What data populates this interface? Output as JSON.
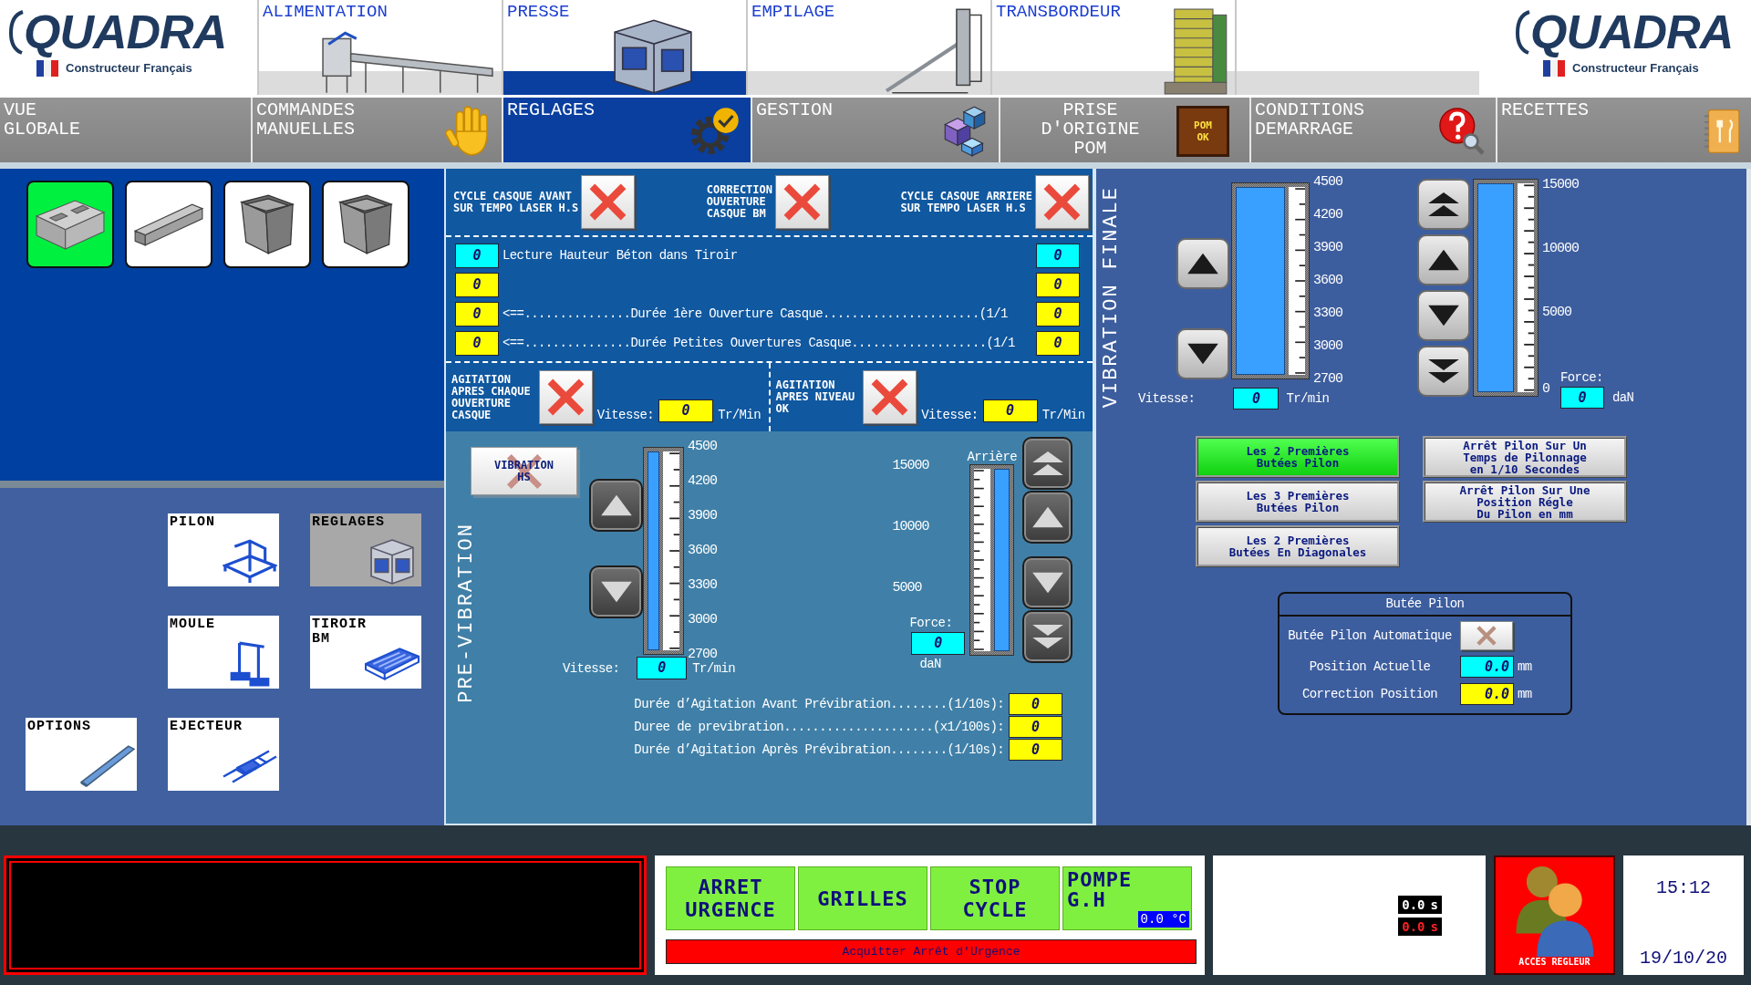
{
  "header": {
    "logos": [
      {
        "brand": "QUADRA",
        "tagline": "Constructeur Français"
      },
      {
        "brand": "QUADRA",
        "tagline": "Constructeur Français"
      }
    ],
    "sections": [
      {
        "label": "ALIMENTATION",
        "selected": false
      },
      {
        "label": "PRESSE",
        "selected": true
      },
      {
        "label": "EMPILAGE",
        "selected": false
      },
      {
        "label": "TRANSBORDEUR",
        "selected": false
      }
    ]
  },
  "menu": [
    {
      "label": "VUE\nGLOBALE",
      "selected": false
    },
    {
      "label": "COMMANDES\nMANUELLES",
      "selected": false
    },
    {
      "label": "REGLAGES",
      "selected": true
    },
    {
      "label": "GESTION",
      "selected": false
    },
    {
      "label": "PRISE\nD'ORIGINE\nPOM",
      "selected": false,
      "badge": "POM\nOK"
    },
    {
      "label": "CONDITIONS\nDEMARRAGE",
      "selected": false
    },
    {
      "label": "RECETTES",
      "selected": false
    }
  ],
  "left_panel": {
    "block_types": [
      {
        "selected": true
      },
      {
        "selected": false
      },
      {
        "selected": false
      },
      {
        "selected": false
      }
    ],
    "components": [
      {
        "label": "PILON",
        "selected": false
      },
      {
        "label": "REGLAGES",
        "selected": true
      },
      {
        "label": "MOULE",
        "selected": false
      },
      {
        "label": "TIROIR\nBM",
        "selected": false
      },
      {
        "label": "OPTIONS",
        "selected": false
      },
      {
        "label": "EJECTEUR",
        "selected": false
      }
    ]
  },
  "casque": {
    "toggles": [
      {
        "label": "CYCLE CASQUE AVANT\nSUR TEMPO LASER H.S",
        "on": false
      },
      {
        "label": "CORRECTION\nOUVERTURE\nCASQUE BM",
        "on": false
      },
      {
        "label": "CYCLE CASQUE ARRIERE\nSUR TEMPO LASER H.S",
        "on": false
      }
    ],
    "rows": [
      {
        "left": {
          "value": "0",
          "kind": "display"
        },
        "text": "Lecture Hauteur Béton dans Tiroir",
        "right": {
          "value": "0",
          "kind": "display"
        }
      },
      {
        "left": {
          "value": "0",
          "kind": "input"
        },
        "right": {
          "value": "0",
          "kind": "input"
        }
      },
      {
        "left": {
          "value": "0",
          "kind": "input"
        },
        "text": "<==...............Durée 1ère Ouverture Casque......................(1/1",
        "right": {
          "value": "0",
          "kind": "input"
        }
      },
      {
        "left": {
          "value": "0",
          "kind": "input"
        },
        "text": "<==...............Durée Petites Ouvertures Casque...................(1/1",
        "right": {
          "value": "0",
          "kind": "input"
        }
      }
    ],
    "agitation": [
      {
        "label": "AGITATION\nAPRES CHAQUE\nOUVERTURE\nCASQUE",
        "on": false,
        "speed_label": "Vitesse:",
        "speed": {
          "value": "0",
          "kind": "input"
        },
        "unit": "Tr/Min"
      },
      {
        "label": "AGITATION\nAPRES NIVEAU\nOK",
        "on": false,
        "speed_label": "Vitesse:",
        "speed": {
          "value": "0",
          "kind": "input"
        },
        "unit": "Tr/Min"
      }
    ]
  },
  "pre_vibration": {
    "title": "PRE-VIBRATION",
    "status": "VIBRATION\nHS",
    "speed": {
      "buttons": [
        {
          "kind": "up"
        },
        {
          "kind": "down"
        }
      ],
      "scale": [
        "4500",
        "4200",
        "3900",
        "3600",
        "3300",
        "3000",
        "2700"
      ],
      "level": 1,
      "label": "Vitesse:",
      "field": {
        "value": "0",
        "kind": "display"
      },
      "unit": "Tr/min"
    },
    "force": {
      "caption": "Arrière",
      "scale": [
        "15000",
        "10000",
        "5000"
      ],
      "level": 1,
      "label": "Force:",
      "field": {
        "value": "0",
        "kind": "display"
      },
      "unit": "daN",
      "buttons": [
        {
          "kind": "double_up"
        },
        {
          "kind": "up"
        },
        {
          "kind": "down"
        },
        {
          "kind": "double_down"
        }
      ]
    },
    "durations": [
      {
        "label": "Durée d’Agitation Avant Prévibration........(1/10s):",
        "field": {
          "value": "0",
          "kind": "input"
        }
      },
      {
        "label": "Duree de previbration.....................(x1/100s):",
        "field": {
          "value": "0",
          "kind": "input"
        }
      },
      {
        "label": "Durée d’Agitation Après Prévibration........(1/10s):",
        "field": {
          "value": "0",
          "kind": "input"
        }
      }
    ]
  },
  "vibration_finale": {
    "title": "VIBRATION FINALE",
    "speed": {
      "buttons": [
        {
          "kind": "up"
        },
        {
          "kind": "down"
        }
      ],
      "scale": [
        "4500",
        "4200",
        "3900",
        "3600",
        "3300",
        "3000",
        "2700"
      ],
      "level": 1,
      "label": "Vitesse:",
      "field": {
        "value": "0",
        "kind": "display"
      },
      "unit": "Tr/min"
    },
    "force": {
      "buttons": [
        {
          "kind": "double_up"
        },
        {
          "kind": "up"
        },
        {
          "kind": "down"
        },
        {
          "kind": "double_down"
        }
      ],
      "scale": [
        "15000",
        "10000",
        "5000",
        "0"
      ],
      "level": 1,
      "label": "Force:",
      "field": {
        "value": "0",
        "kind": "display"
      },
      "unit": "daN"
    },
    "modes": [
      [
        {
          "label": "Les 2 Premières\nButées Pilon",
          "selected": true
        },
        {
          "label": "Les 3 Premières\nButées Pilon",
          "selected": false
        },
        {
          "label": "Les 2 Premières\nButées En Diagonales",
          "selected": false
        }
      ],
      [
        {
          "label": "Arrêt Pilon Sur Un\nTemps de Pilonnage\nen 1/10 Secondes",
          "selected": false
        },
        {
          "label": "Arrêt Pilon Sur Une\nPosition Régle\nDu Pilon en mm",
          "selected": false
        }
      ]
    ],
    "butee": {
      "title": "Butée Pilon",
      "auto": {
        "label": "Butée Pilon Automatique",
        "on": false,
        "disabled": true
      },
      "rows": [
        {
          "label": "Position Actuelle",
          "field": {
            "value": "0.0",
            "kind": "display"
          },
          "unit": "mm"
        },
        {
          "label": "Correction Position",
          "field": {
            "value": "0.0",
            "kind": "input"
          },
          "unit": "mm"
        }
      ]
    }
  },
  "footer": {
    "controls": [
      {
        "label": "ARRET\nURGENCE"
      },
      {
        "label": "GRILLES"
      },
      {
        "label": "STOP\nCYCLE"
      },
      {
        "label": "POMPE\nG.H",
        "reading": "0.0 °C"
      }
    ],
    "acknowledge": "Acquitter Arrêt d'Urgence",
    "timers": [
      {
        "value": "0.0",
        "unit": "s",
        "kind": "normal"
      },
      {
        "value": "0.0",
        "unit": "s",
        "kind": "alert"
      }
    ],
    "access": "ACCES REGLEUR",
    "clock": {
      "time": "15:12",
      "date": "19/10/20"
    }
  }
}
